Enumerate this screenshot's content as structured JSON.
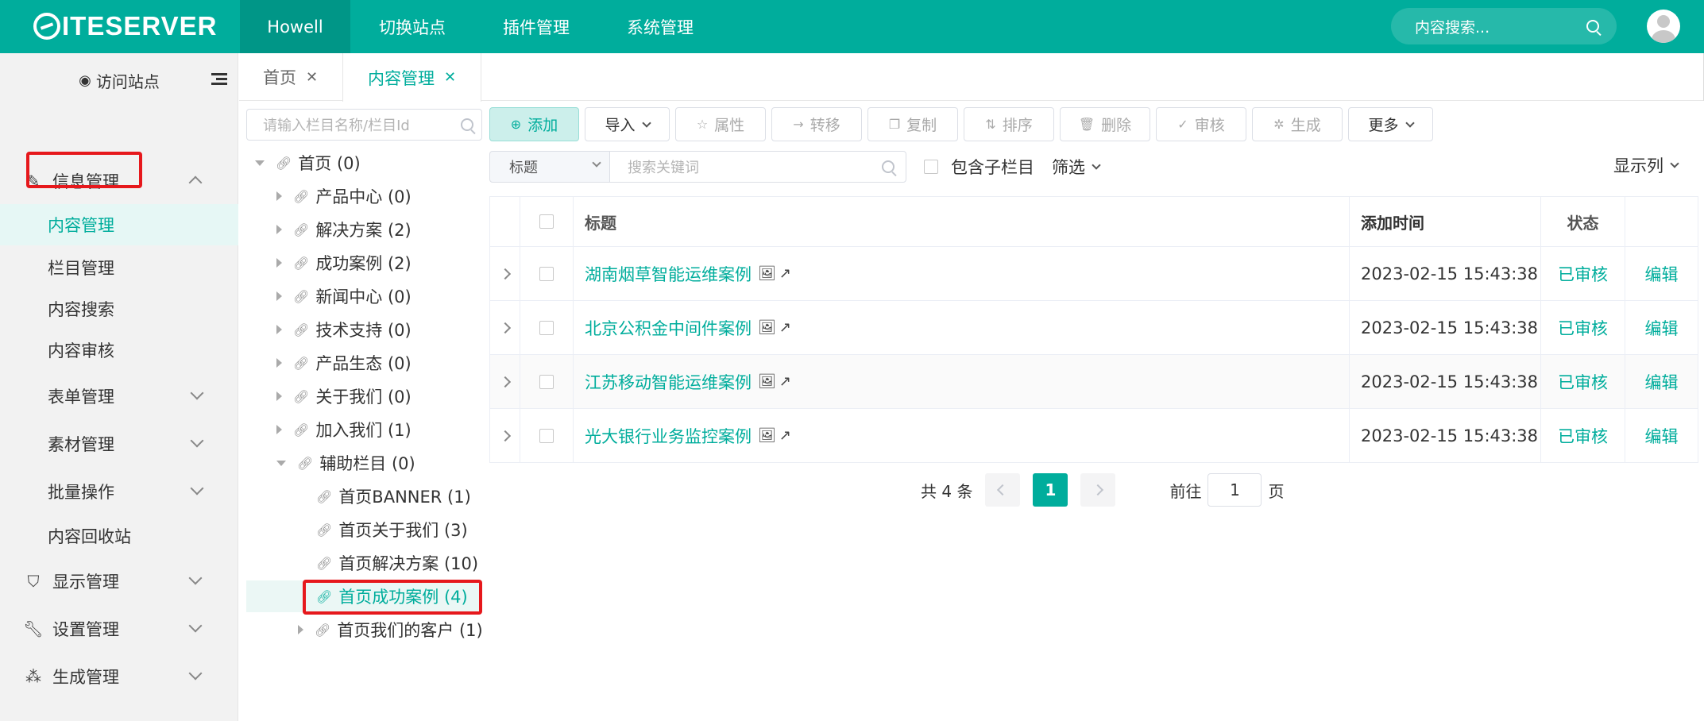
{
  "brand": {
    "logo_text": "ITESERVER",
    "accent": "#00ad9c"
  },
  "topnav": {
    "items": [
      "Howell",
      "切换站点",
      "插件管理",
      "系统管理"
    ],
    "search_placeholder": "内容搜索..."
  },
  "sidebar": {
    "visit_site": "访问站点",
    "groups": {
      "info": "信息管理",
      "display": "显示管理",
      "settings": "设置管理",
      "generate": "生成管理"
    },
    "info_items": {
      "content_manage": "内容管理",
      "column_manage": "栏目管理",
      "content_search": "内容搜索",
      "content_review": "内容审核",
      "form_manage": "表单管理",
      "material_manage": "素材管理",
      "batch_ops": "批量操作",
      "recycle": "内容回收站"
    }
  },
  "tabs": {
    "home": "首页",
    "content": "内容管理",
    "close": "✕"
  },
  "tree": {
    "search_placeholder": "请输入栏目名称/栏目Id",
    "nodes": {
      "root": "首页 (0)",
      "n1": "产品中心 (0)",
      "n2": "解决方案 (2)",
      "n3": "成功案例 (2)",
      "n4": "新闻中心 (0)",
      "n5": "技术支持 (0)",
      "n6": "产品生态 (0)",
      "n7": "关于我们 (0)",
      "n8": "加入我们 (1)",
      "n9": "辅助栏目 (0)",
      "c1": "首页BANNER (1)",
      "c2": "首页关于我们 (3)",
      "c3": "首页解决方案 (10)",
      "c4": "首页成功案例 (4)",
      "c5": "首页我们的客户 (1)"
    }
  },
  "toolbar": {
    "add": "添加",
    "import": "导入",
    "attr": "属性",
    "move": "转移",
    "copy": "复制",
    "sort": "排序",
    "delete": "删除",
    "review": "审核",
    "generate": "生成",
    "more": "更多"
  },
  "filters": {
    "type": "标题",
    "keyword_placeholder": "搜索关键词",
    "include_sub": "包含子栏目",
    "filter": "筛选",
    "display_cols": "显示列"
  },
  "table": {
    "headers": {
      "title": "标题",
      "time": "添加时间",
      "status": "状态"
    },
    "rows": [
      {
        "title": "湖南烟草智能运维案例",
        "time": "2023-02-15 15:43:38",
        "status": "已审核",
        "action": "编辑"
      },
      {
        "title": "北京公积金中间件案例",
        "time": "2023-02-15 15:43:38",
        "status": "已审核",
        "action": "编辑"
      },
      {
        "title": "江苏移动智能运维案例",
        "time": "2023-02-15 15:43:38",
        "status": "已审核",
        "action": "编辑"
      },
      {
        "title": "光大银行业务监控案例",
        "time": "2023-02-15 15:43:38",
        "status": "已审核",
        "action": "编辑"
      }
    ]
  },
  "pager": {
    "total": "共 4 条",
    "current": "1",
    "goto_label": "前往",
    "goto_value": "1",
    "page_suffix": "页"
  }
}
